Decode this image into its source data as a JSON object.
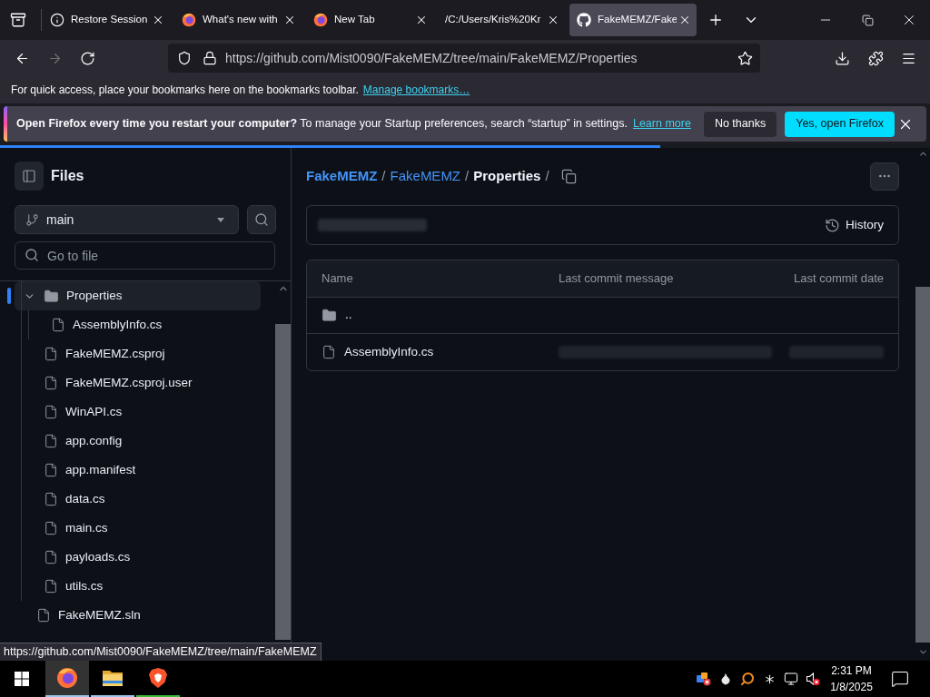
{
  "browser": {
    "tabs": [
      {
        "title": "Restore Session",
        "kind": "info",
        "selected": false
      },
      {
        "title": "What's new with",
        "kind": "firefox",
        "selected": false
      },
      {
        "title": "New Tab",
        "kind": "firefox",
        "selected": false
      },
      {
        "title": "/C:/Users/Kris%20Kr",
        "kind": "plain",
        "selected": false
      },
      {
        "title": "FakeMEMZ/Fake",
        "kind": "github",
        "selected": true
      }
    ],
    "navigation": {
      "back": {
        "disabled": false
      },
      "forward": {
        "disabled": true
      }
    },
    "url": "https://github.com/Mist0090/FakeMEMZ/tree/main/FakeMEMZ/Properties",
    "bookmarks_hint": "For quick access, place your bookmarks here on the bookmarks toolbar.",
    "bookmarks_link": "Manage bookmarks…",
    "notification": {
      "message": "**Open Firefox every time you restart your computer?** To manage your Startup preferences, search “startup” in settings.",
      "link": "Learn more",
      "buttons": [
        {
          "label": "No thanks",
          "kind": "secondary"
        },
        {
          "label": "Yes, open Firefox",
          "kind": "primary"
        }
      ]
    },
    "loading_bar": {
      "level": 0.71
    },
    "status_link": "https://github.com/Mist0090/FakeMEMZ/tree/main/FakeMEMZ"
  },
  "page": {
    "sidebar": {
      "title": "Files",
      "branch": "main",
      "search_placeholder": "Go to file",
      "tree": [
        {
          "kind": "group",
          "children": [
            {
              "name": "Properties",
              "kind": "folder",
              "expanded": true,
              "selected": true,
              "children": [
                {
                  "name": "AssemblyInfo.cs",
                  "kind": "file",
                  "selected": false
                }
              ]
            },
            {
              "name": "FakeMEMZ.csproj",
              "kind": "file",
              "selected": false
            },
            {
              "name": "FakeMEMZ.csproj.user",
              "kind": "file",
              "selected": false
            },
            {
              "name": "WinAPI.cs",
              "kind": "file",
              "selected": false
            },
            {
              "name": "app.config",
              "kind": "file",
              "selected": false
            },
            {
              "name": "app.manifest",
              "kind": "file",
              "selected": false
            },
            {
              "name": "data.cs",
              "kind": "file",
              "selected": false
            },
            {
              "name": "main.cs",
              "kind": "file",
              "selected": false
            },
            {
              "name": "payloads.cs",
              "kind": "file",
              "selected": false
            },
            {
              "name": "utils.cs",
              "kind": "file",
              "selected": false
            }
          ]
        },
        {
          "name": "FakeMEMZ.sln",
          "kind": "file",
          "selected": false
        }
      ]
    },
    "breadcrumb": [
      {
        "label": "FakeMEMZ",
        "kind": "repo",
        "separator": "/"
      },
      {
        "label": "FakeMEMZ",
        "kind": "link",
        "separator": "/"
      },
      {
        "label": "Properties",
        "kind": "current",
        "separator": "/"
      }
    ],
    "history_button": "History",
    "table": {
      "columns": [
        "Name",
        "Last commit message",
        "Last commit date"
      ],
      "rows": [
        {
          "name": "..",
          "kind": "folder",
          "blurred": false
        },
        {
          "name": "AssemblyInfo.cs",
          "kind": "file",
          "blurred": true
        }
      ]
    }
  },
  "taskbar": {
    "apps": [
      {
        "kind": "firefox",
        "selected": true,
        "color": "#9fc3ea"
      },
      {
        "kind": "explorer",
        "selected": false,
        "color": "#9fc3ea"
      },
      {
        "kind": "brave",
        "selected": false,
        "color": "#3dbb3d"
      }
    ],
    "time": "2:31 PM",
    "date": "1/8/2025"
  }
}
